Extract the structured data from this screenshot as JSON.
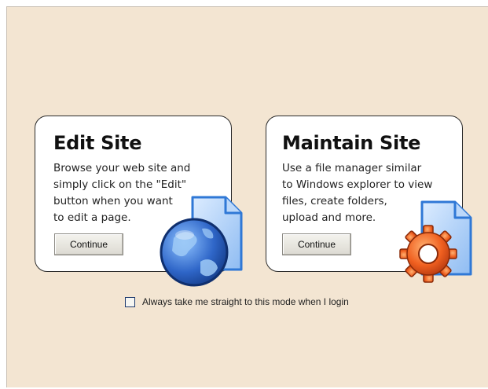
{
  "cards": [
    {
      "title": "Edit Site",
      "description": "Browse your web site and\nsimply click on the \"Edit\"\nbutton when you want\nto edit a page.",
      "button_label": "Continue",
      "icon": "globe-document-icon"
    },
    {
      "title": "Maintain Site",
      "description": "Use a file manager similar\nto Windows explorer to view\nfiles, create folders,\nupload and more.",
      "button_label": "Continue",
      "icon": "gear-document-icon"
    }
  ],
  "default_mode_option": {
    "label": "Always take me straight to this mode when I login",
    "checked": false
  },
  "colors": {
    "background": "#f3e5d2",
    "card": "#ffffff",
    "document_blue": "#4a90e2",
    "globe_blue": "#2f66c8",
    "gear_orange": "#f06020"
  }
}
